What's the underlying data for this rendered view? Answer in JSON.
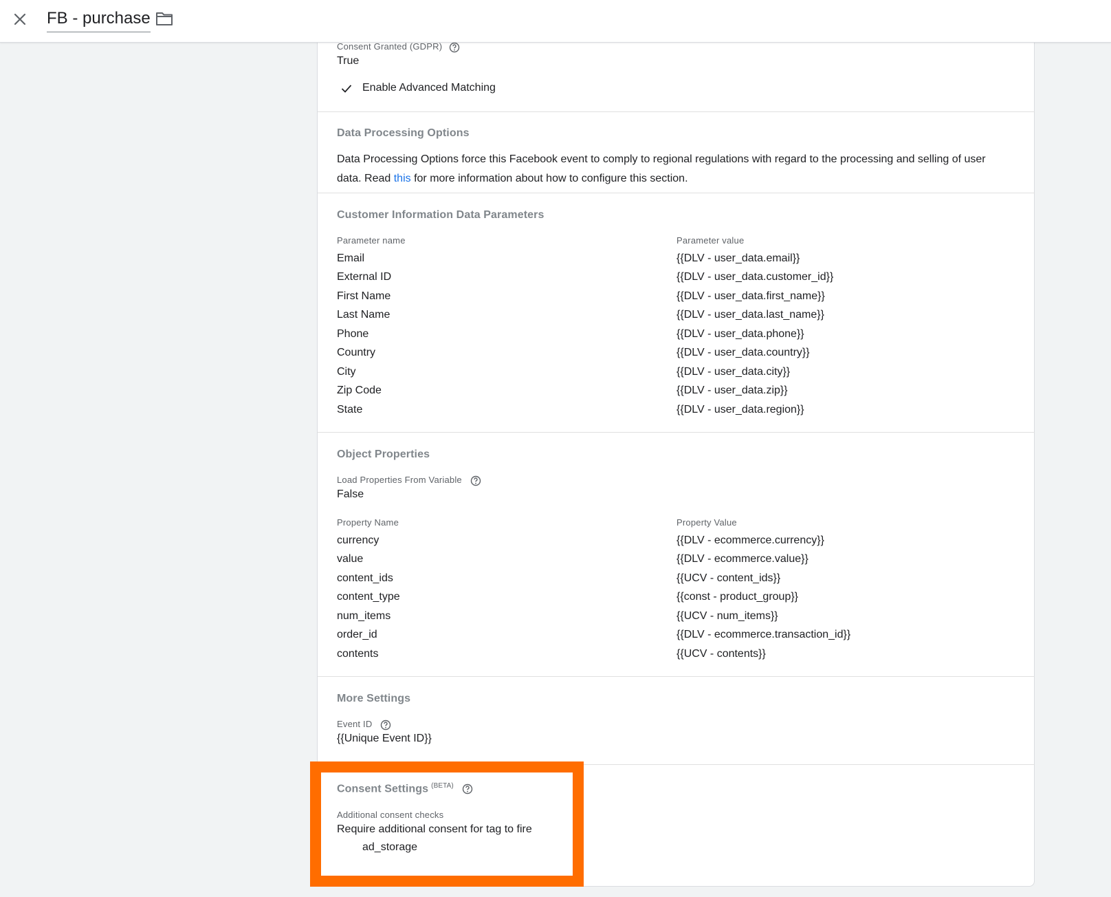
{
  "header": {
    "title": "FB - purchase"
  },
  "consent_granted": {
    "label": "Consent Granted (GDPR)",
    "value": "True"
  },
  "advanced_matching": {
    "label": "Enable Advanced Matching"
  },
  "data_processing": {
    "title": "Data Processing Options",
    "text_before": "Data Processing Options force this Facebook event to comply to regional regulations with regard to the processing and selling of user data. Read ",
    "link": "this",
    "text_after": " for more information about how to configure this section."
  },
  "customer_info": {
    "title": "Customer Information Data Parameters",
    "col_name": "Parameter name",
    "col_value": "Parameter value",
    "rows": [
      {
        "name": "Email",
        "value": "{{DLV - user_data.email}}"
      },
      {
        "name": "External ID",
        "value": "{{DLV - user_data.customer_id}}"
      },
      {
        "name": "First Name",
        "value": "{{DLV - user_data.first_name}}"
      },
      {
        "name": "Last Name",
        "value": "{{DLV - user_data.last_name}}"
      },
      {
        "name": "Phone",
        "value": "{{DLV - user_data.phone}}"
      },
      {
        "name": "Country",
        "value": "{{DLV - user_data.country}}"
      },
      {
        "name": "City",
        "value": "{{DLV - user_data.city}}"
      },
      {
        "name": "Zip Code",
        "value": "{{DLV - user_data.zip}}"
      },
      {
        "name": "State",
        "value": "{{DLV - user_data.region}}"
      }
    ]
  },
  "object_properties": {
    "title": "Object Properties",
    "load_label": "Load Properties From Variable",
    "load_value": "False",
    "col_name": "Property Name",
    "col_value": "Property Value",
    "rows": [
      {
        "name": "currency",
        "value": "{{DLV - ecommerce.currency}}"
      },
      {
        "name": "value",
        "value": "{{DLV - ecommerce.value}}"
      },
      {
        "name": "content_ids",
        "value": "{{UCV - content_ids}}"
      },
      {
        "name": "content_type",
        "value": "{{const - product_group}}"
      },
      {
        "name": "num_items",
        "value": "{{UCV - num_items}}"
      },
      {
        "name": "order_id",
        "value": "{{DLV - ecommerce.transaction_id}}"
      },
      {
        "name": "contents",
        "value": "{{UCV - contents}}"
      }
    ]
  },
  "more_settings": {
    "title": "More Settings",
    "event_id_label": "Event ID",
    "event_id_value": "{{Unique Event ID}}"
  },
  "consent_settings": {
    "title": "Consent Settings",
    "beta": "(BETA)",
    "checks_label": "Additional consent checks",
    "checks_value": "Require additional consent for tag to fire",
    "consent_type": "ad_storage"
  },
  "colors": {
    "highlight": "#ff6d00",
    "link": "#1a73e8"
  }
}
